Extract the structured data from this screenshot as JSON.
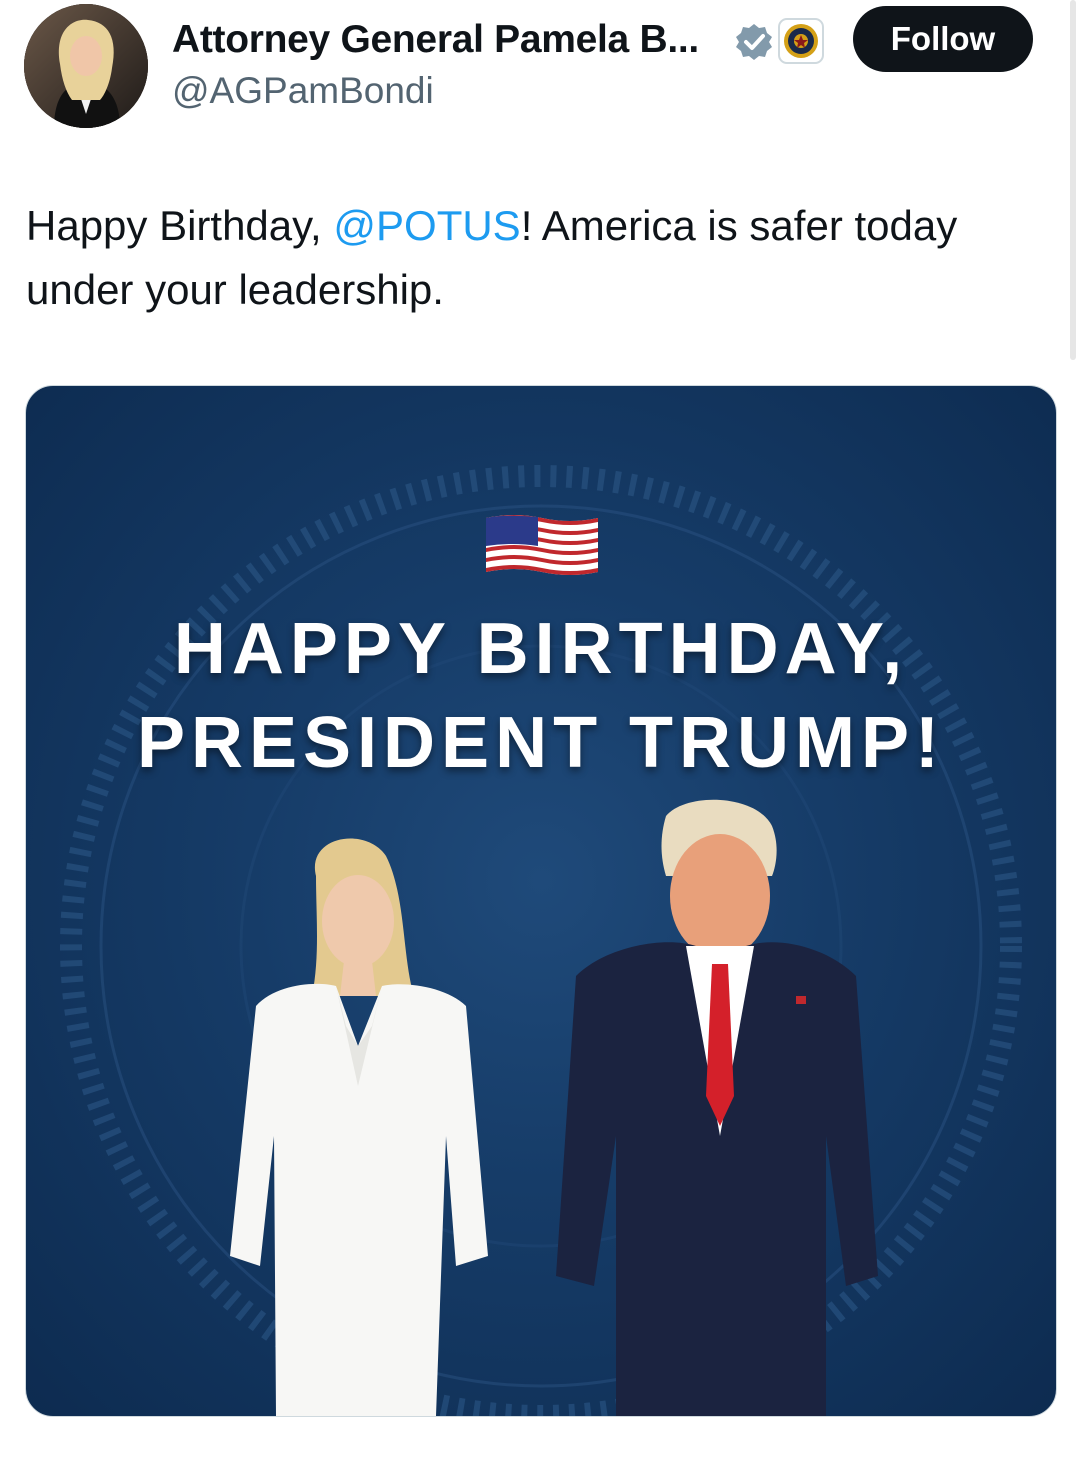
{
  "author": {
    "display_name": "Attorney General Pamela B...",
    "handle": "@AGPamBondi",
    "avatar_icon": "profile-photo",
    "verified_icon": "verified-badge-icon",
    "affiliation_icon": "doj-seal-icon"
  },
  "follow_label": "Follow",
  "tweet": {
    "text_before": "Happy Birthday, ",
    "mention": "@POTUS",
    "text_after": "! America is safer today under your leadership."
  },
  "media": {
    "flag_icon": "us-flag-icon",
    "headline_line1": "HAPPY BIRTHDAY,",
    "headline_line2": "PRESIDENT TRUMP!"
  },
  "colors": {
    "link": "#1d9bf0",
    "follow_bg": "#0f1419",
    "media_bg": "#163c68"
  }
}
